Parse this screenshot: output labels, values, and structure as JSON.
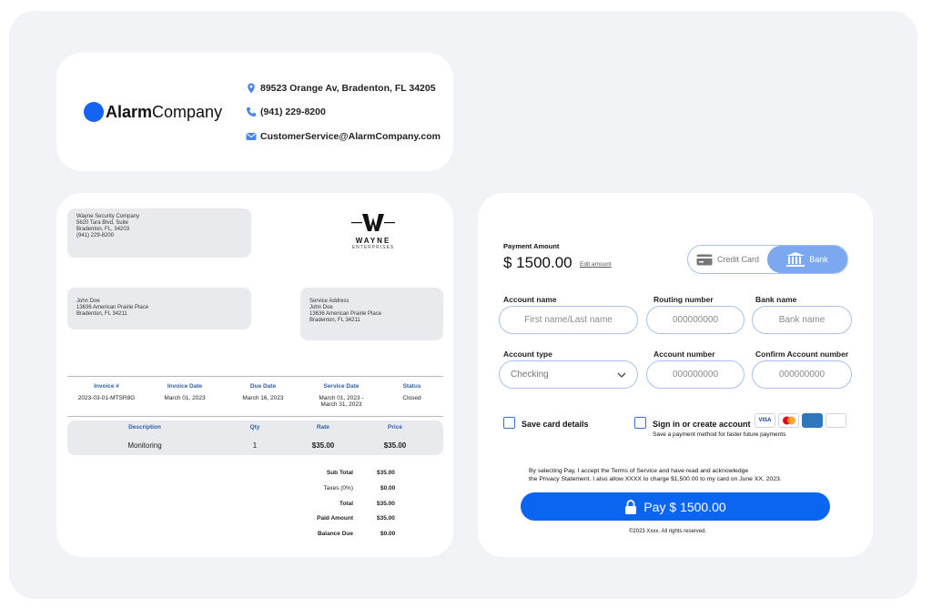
{
  "header": {
    "logo_bold": "Alarm",
    "logo_light": "Company",
    "address": "89523 Orange Av, Bradenton, FL 34205",
    "phone": "(941) 229-8200",
    "email": "CustomerService@AlarmCompany.com"
  },
  "invoice": {
    "company_lines": [
      "Wayne Security Company",
      "5620 Tara Blvd, Suite",
      "Bradenton, FL, 34203",
      "(941) 229-8200"
    ],
    "brand_name": "WAYNE",
    "brand_sub": "ENTERPRISES",
    "bill_to": [
      "John Doe",
      "13636 American Prairie Place",
      "Bradenton, FL 34211"
    ],
    "service_address": [
      "Service Address",
      "John Doe",
      "13636 American Prairie Place",
      "Bradenton, FL 34211"
    ],
    "headers": [
      "Invoice #",
      "Invoice Date",
      "Due Date",
      "Service Date",
      "Status"
    ],
    "row": [
      "2023-03-01-MTSR8G",
      "March 01, 2023",
      "March 16, 2023",
      "March 01, 2023 -",
      "Closed"
    ],
    "service_date_end": "March 31, 2023",
    "item_headers": [
      "Description",
      "Qty",
      "Rate",
      "Price"
    ],
    "item_row": [
      "Monitoring",
      "1",
      "$35.00",
      "$35.00"
    ],
    "totals": [
      {
        "label": "Sub Total",
        "value": "$35.00"
      },
      {
        "label": "Taxes (0%)",
        "value": "$0.00"
      },
      {
        "label": "Total",
        "value": "$35.00"
      },
      {
        "label": "Paid Amount",
        "value": "$35.00"
      },
      {
        "label": "Balance Due",
        "value": "$0.00"
      }
    ]
  },
  "payment": {
    "amount_label": "Payment Amount",
    "amount": "$ 1500.00",
    "edit_link": "Edit amount",
    "method_credit": "Credit Card",
    "method_bank": "Bank",
    "account_name_label": "Account name",
    "account_name_placeholder": "First name/Last name",
    "routing_label": "Routing number",
    "routing_placeholder": "000000000",
    "bank_name_label": "Bank name",
    "bank_name_placeholder": "Bank name",
    "account_type_label": "Account type",
    "account_type_value": "Checking",
    "account_number_label": "Account number",
    "account_number_placeholder": "000000000",
    "confirm_label": "Confirm Account number",
    "confirm_placeholder": "000000000",
    "save_card": "Save card details",
    "sign_in": "Sign in or create account",
    "sign_in_sub": "Save a payment method for faster future payments",
    "card_brands": [
      "VISA",
      "MC",
      "AMEX",
      "DISCOVER"
    ],
    "terms_1": "By selecting Pay, I accept the Terms of Service and have read and acknowledge",
    "terms_2": "the Privacy Statement. I also allow XXXX to charge $1,500.00 to my card on June XX, 2023.",
    "pay_button": "Pay $ 1500.00",
    "copyright": "©2023 Xxxx. All rights reserved."
  },
  "colors": {
    "accent": "#0a66f0",
    "bank_active": "#7ba8ef",
    "frame": "#f1f3f7"
  }
}
